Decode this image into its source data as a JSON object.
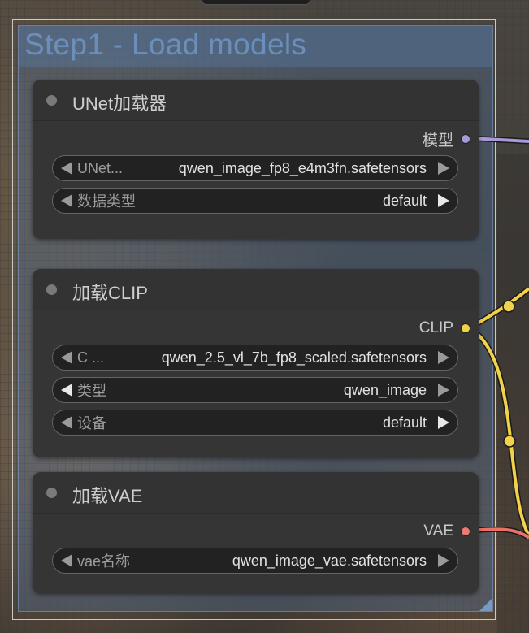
{
  "group": {
    "title": "Step1 - Load models"
  },
  "nodes": [
    {
      "title": "UNet加载器",
      "output": {
        "label": "模型",
        "color": "#a89ad8"
      },
      "widgets": [
        {
          "name": "UNet...",
          "value": "qwen_image_fp8_e4m3fn.safetensors"
        },
        {
          "name": "数据类型",
          "value": "default"
        }
      ]
    },
    {
      "title": "加载CLIP",
      "output": {
        "label": "CLIP",
        "color": "#f2d24a"
      },
      "widgets": [
        {
          "name": "C ...",
          "value": "qwen_2.5_vl_7b_fp8_scaled.safetensors"
        },
        {
          "name": "类型",
          "value": "qwen_image"
        },
        {
          "name": "设备",
          "value": "default"
        }
      ]
    },
    {
      "title": "加载VAE",
      "output": {
        "label": "VAE",
        "color": "#f07a72"
      },
      "widgets": [
        {
          "name": "vae名称",
          "value": "qwen_image_vae.safetensors"
        }
      ]
    }
  ],
  "colors": {
    "model_wire": "#a89ad8",
    "clip_wire": "#f2d24a",
    "vae_wire": "#e87268",
    "group_accent": "#6e96c8"
  }
}
